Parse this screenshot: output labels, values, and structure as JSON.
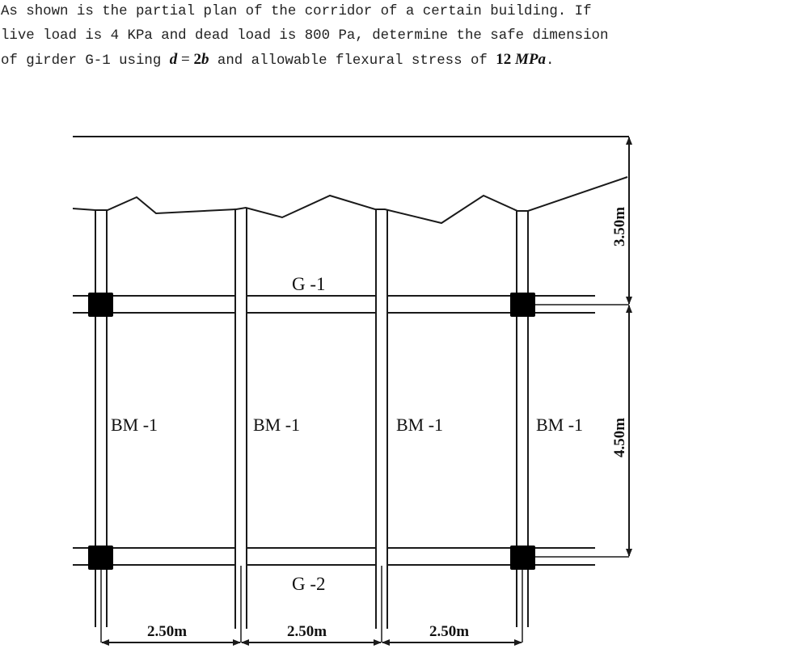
{
  "problem": {
    "line1": "As shown is the partial plan of the corridor of a certain building. If",
    "line2": "live load is 4 KPa and dead load is 800 Pa, determine the safe dimension",
    "line3_prefix": "of girder G-1 using ",
    "relation": {
      "lhs": "d",
      "eq": " = ",
      "coef": "2",
      "var": "b"
    },
    "line3_mid": " and allowable flexural stress of ",
    "stress_value": "12",
    "stress_unit": "MPa",
    "line3_end": ".",
    "given": {
      "live_load": "4 KPa",
      "dead_load": "800 Pa",
      "depth_relation": "d = 2b",
      "allowable_flexural_stress": "12 MPa"
    }
  },
  "diagram": {
    "girder_labels": [
      "G -1",
      "G -2"
    ],
    "beam_labels": [
      "BM -1",
      "BM -1",
      "BM -1",
      "BM -1"
    ],
    "dimensions": {
      "horizontal": [
        "2.50m",
        "2.50m",
        "2.50m"
      ],
      "vertical": [
        "3.50m",
        "4.50m"
      ]
    },
    "colors": {
      "line": "#1a1a1a",
      "column": "#000000",
      "background": "#ffffff"
    }
  }
}
